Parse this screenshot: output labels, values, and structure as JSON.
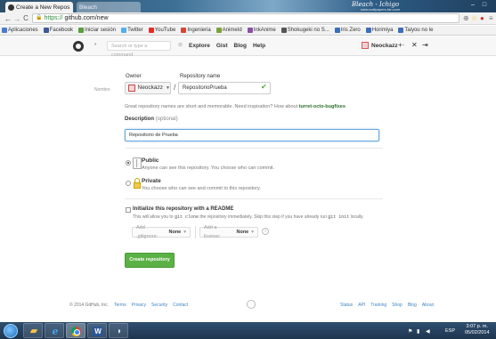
{
  "browser": {
    "active_tab_title": "Create a New Repos",
    "inactive_tab_title": "Bleach",
    "url_scheme": "https://",
    "url_rest": "github.com/new",
    "desktop_title": "Bleach - Ichigo",
    "desktop_subtitle": "www.wallpapers-fan.com"
  },
  "bookmarks": [
    {
      "label": "Aplicaciones",
      "color": "#4a7bd0"
    },
    {
      "label": "Facebook",
      "color": "#3b5998"
    },
    {
      "label": "Iniciar sesión",
      "color": "#5a9e3f"
    },
    {
      "label": "Twitter",
      "color": "#55acee"
    },
    {
      "label": "YouTube",
      "color": "#e52d27"
    },
    {
      "label": "Ingenieria",
      "color": "#d44638"
    },
    {
      "label": "AnimeId",
      "color": "#7aa33a"
    },
    {
      "label": "InkAnime",
      "color": "#8a4fa6"
    },
    {
      "label": "Shokugeki no S...",
      "color": "#555555"
    },
    {
      "label": "Iris Zero",
      "color": "#3b6fb6"
    },
    {
      "label": "Horimiya",
      "color": "#3b6fb6"
    },
    {
      "label": "Taiyou no le",
      "color": "#3b6fb6"
    }
  ],
  "github_header": {
    "search_placeholder": "Search or type a command",
    "nav": [
      "Explore",
      "Gist",
      "Blog",
      "Help"
    ],
    "username": "Neockazz"
  },
  "form": {
    "owner_label": "Owner",
    "repo_label": "Repository name",
    "fake_label": "Nombre",
    "owner_value": "Neockazz",
    "repo_value": "RepositorioPrueba",
    "hint_text": "Great repository names are short and memorable. Need inspiration? How about",
    "hint_suggestion": "turret-octo-bugfixes",
    "description_label": "Description",
    "description_optional": "(optional)",
    "description_value": "Repositorio de Prueba",
    "public_title": "Public",
    "public_desc": "Anyone can see this repository. You choose who can commit.",
    "private_title": "Private",
    "private_desc": "You choose who can see and commit to this repository.",
    "init_title": "Initialize this repository with a README",
    "init_desc_1": "This will allow you to",
    "init_desc_code1": "git clone",
    "init_desc_2": "the repository immediately. Skip this step if you have already run",
    "init_desc_code2": "git init",
    "init_desc_3": "locally.",
    "gitignore_label": "Add .gitignore:",
    "gitignore_value": "None",
    "license_label": "Add a license:",
    "license_value": "None",
    "create_button": "Create repository"
  },
  "footer": {
    "copyright": "© 2014 GitHub, Inc.",
    "left_links": [
      "Terms",
      "Privacy",
      "Security",
      "Contact"
    ],
    "right_links": [
      "Status",
      "API",
      "Training",
      "Shop",
      "Blog",
      "About"
    ]
  },
  "taskbar": {
    "language": "ESP",
    "time": "3:07 p. m.",
    "date": "05/02/2014"
  },
  "colors": {
    "create_button": "#5bb145",
    "link": "#4183c4",
    "suggestion": "#2c6f2a"
  }
}
